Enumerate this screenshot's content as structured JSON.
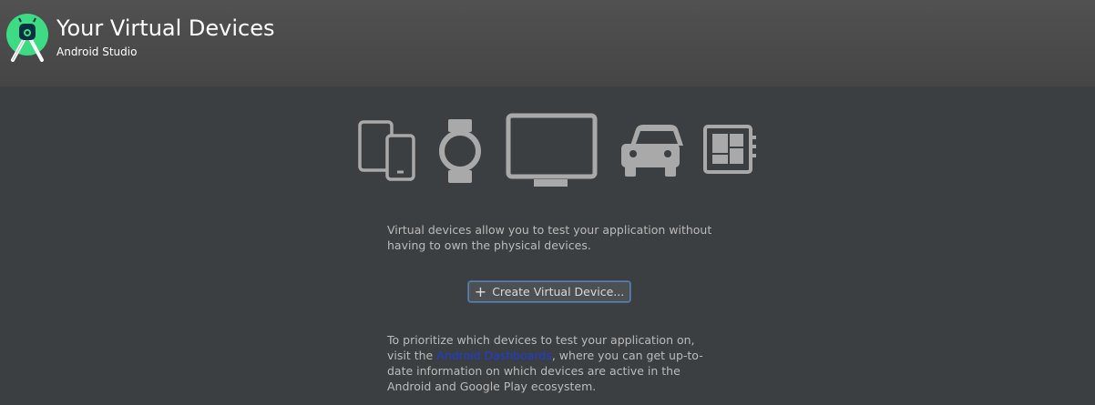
{
  "header": {
    "title": "Your Virtual Devices",
    "subtitle": "Android Studio",
    "logo_icon": "android-studio-logo-icon"
  },
  "device_icons": [
    {
      "name": "phone-tablet-icon"
    },
    {
      "name": "watch-icon"
    },
    {
      "name": "tv-icon"
    },
    {
      "name": "car-icon"
    },
    {
      "name": "things-board-icon"
    }
  ],
  "main": {
    "description": "Virtual devices allow you to test your application without having to own the physical devices.",
    "create_button_label": "Create Virtual Device...",
    "create_button_icon": "plus-icon",
    "info_prefix": "To prioritize which devices to test your application on, visit the ",
    "info_link": "Android Dashboards",
    "info_suffix": ", where you can get up-to-date information on which devices are active in the Android and Google Play ecosystem."
  },
  "colors": {
    "background": "#3c3f41",
    "header": "#4b4b4b",
    "text": "#bbbbbb",
    "link": "#1d3ed8",
    "icon": "#a9a9a9",
    "logo_green": "#3ddc84"
  }
}
